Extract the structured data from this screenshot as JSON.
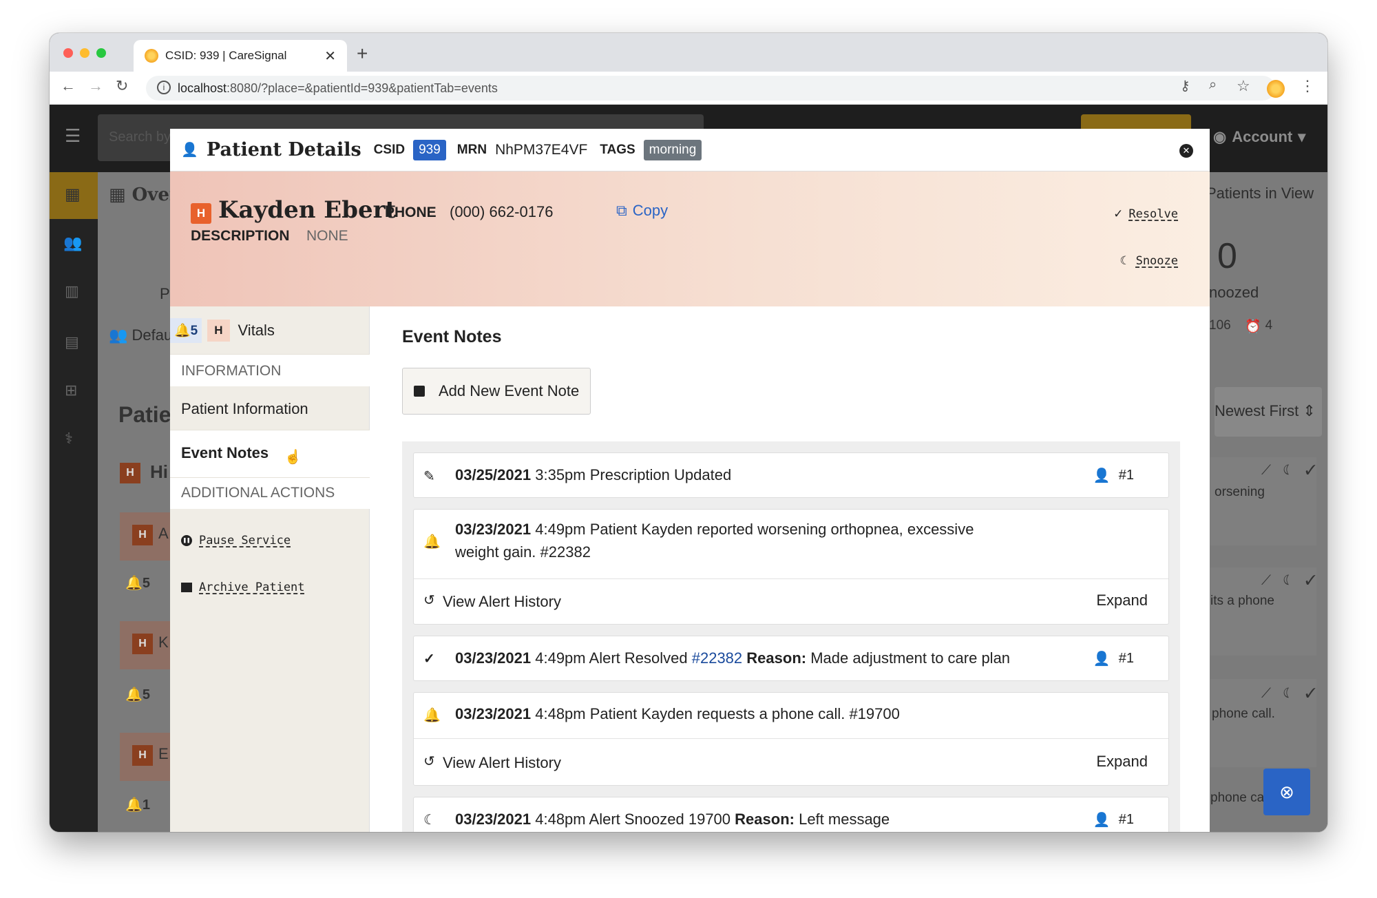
{
  "browser": {
    "tab_title": "CSID: 939 | CareSignal",
    "url_host": "localhost",
    "url_rest": ":8080/?place=&patientId=939&patientTab=events"
  },
  "app": {
    "search_placeholder": "Search by Name, Phone number, ID, MRN",
    "account_label": "Account",
    "overview_label": "Overview",
    "patients_in_view": "Patients in View",
    "snoozed_count": "0",
    "snoozed_label": "noozed",
    "bg_count_a": "106",
    "bg_count_b": "4",
    "default_label": "Default",
    "p_fragment": "P",
    "patients_fragment": "Patie",
    "sort_label": "Newest First",
    "bg_list": [
      {
        "label": "Hi",
        "text": "",
        "bell": ""
      },
      {
        "label": "A",
        "text": "orsening",
        "bell": "5"
      },
      {
        "label": "K",
        "text": "its a phone",
        "bell": "5"
      },
      {
        "label": "E",
        "text": "phone call.",
        "bell": "1"
      }
    ],
    "bg_last_text": "phone call."
  },
  "modal": {
    "title": "Patient Details",
    "csid_label": "CSID",
    "csid_value": "939",
    "mrn_label": "MRN",
    "mrn_value": "NhPM37E4VF",
    "tags_label": "TAGS",
    "tag": "morning",
    "patient_name": "Kayden Ebert",
    "priority": "H",
    "phone_label": "PHONE",
    "phone_value": "(000) 662-0176",
    "copy_label": "Copy",
    "description_label": "DESCRIPTION",
    "description_value": "NONE",
    "resolve_label": "Resolve",
    "snooze_label": "Snooze"
  },
  "sidebar": {
    "vitals_count": "5",
    "vitals_priority": "H",
    "vitals_label": "Vitals",
    "information_header": "INFORMATION",
    "patient_information": "Patient Information",
    "event_notes": "Event Notes",
    "additional_actions_header": "ADDITIONAL ACTIONS",
    "pause_service": "Pause Service",
    "archive_patient": "Archive Patient"
  },
  "main": {
    "heading": "Event Notes",
    "add_button": "Add New Event Note",
    "view_alert_history": "View Alert History",
    "expand": "Expand",
    "events": [
      {
        "date": "03/25/2021",
        "time": "3:35pm",
        "text": "Prescription Updated",
        "user": "#1"
      },
      {
        "date": "03/23/2021",
        "time": "4:49pm",
        "text": "Patient Kayden reported worsening orthopnea, excessive",
        "text2": "weight gain. #22382"
      },
      {
        "date": "03/23/2021",
        "time": "4:49pm",
        "text": "Alert Resolved",
        "link": "#22382",
        "reason_label": "Reason:",
        "reason": "Made adjustment to care plan",
        "user": "#1"
      },
      {
        "date": "03/23/2021",
        "time": "4:48pm",
        "text": "Patient Kayden requests a phone call. #19700"
      },
      {
        "date": "03/23/2021",
        "time": "4:48pm",
        "text": "Alert Snoozed 19700",
        "reason_label": "Reason:",
        "reason": "Left message",
        "user": "#1"
      }
    ]
  },
  "colors": {
    "accent": "#2a64c5",
    "priority": "#e8612c",
    "tag": "#6c757d",
    "appbar": "#1e1e1e"
  }
}
